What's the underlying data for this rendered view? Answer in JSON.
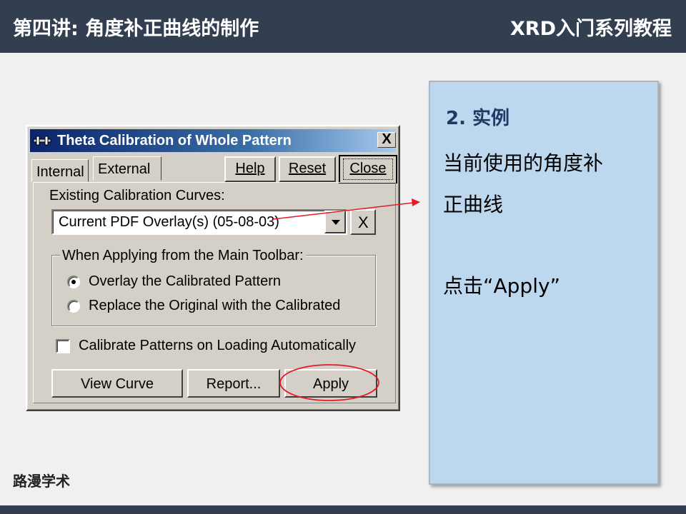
{
  "slide": {
    "title": "第四讲: 角度补正曲线的制作",
    "series": "XRD入门系列教程",
    "brand": "路漫学术"
  },
  "dialog": {
    "title": "Theta Calibration of Whole Pattern",
    "close_glyph": "X",
    "tabs": [
      {
        "label": "Internal",
        "active": false
      },
      {
        "label": "External",
        "active": true
      }
    ],
    "buttons": {
      "help": "Help",
      "reset": "Reset",
      "close": "Close"
    },
    "existing_group_label": "Existing Calibration Curves:",
    "combo_value": "Current PDF Overlay(s) (05-08-03)",
    "delete_glyph": "X",
    "toolbar_group_label": "When Applying from the Main Toolbar:",
    "options": [
      {
        "label": "Overlay the Calibrated Pattern",
        "selected": true
      },
      {
        "label": "Replace the Original with the Calibrated",
        "selected": false
      }
    ],
    "auto_calibrate": {
      "label": "Calibrate Patterns on Loading Automatically",
      "checked": false
    },
    "bottom_buttons": {
      "view_curve": "View Curve",
      "report": "Report...",
      "apply": "Apply"
    }
  },
  "notes": {
    "heading": "2. 实例",
    "line1": "当前使用的角度补",
    "line2": "正曲线",
    "line3": "点击“Apply”"
  },
  "colors": {
    "header_bg": "#333f50",
    "note_bg": "#bdd7ee",
    "highlight": "#e31c23",
    "dialog_face": "#d4d0c8"
  }
}
